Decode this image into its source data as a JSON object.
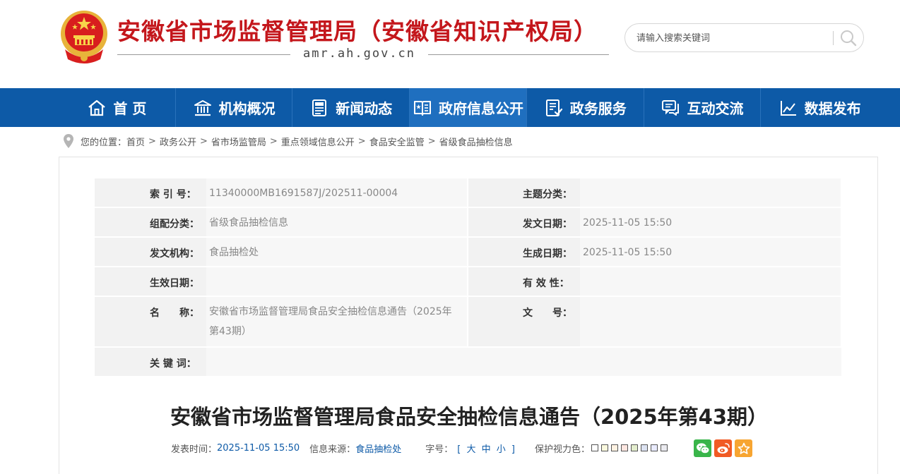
{
  "header": {
    "site_title": "安徽省市场监督管理局（安徽省知识产权局）",
    "domain": "amr.ah.gov.cn",
    "search_placeholder": "请输入搜索关键词"
  },
  "nav": {
    "items": [
      {
        "label": "首 页",
        "icon": "home-icon"
      },
      {
        "label": "机构概况",
        "icon": "institution-icon"
      },
      {
        "label": "新闻动态",
        "icon": "news-icon"
      },
      {
        "label": "政府信息公开",
        "icon": "gov-info-icon"
      },
      {
        "label": "政务服务",
        "icon": "service-icon"
      },
      {
        "label": "互动交流",
        "icon": "chat-icon"
      },
      {
        "label": "数据发布",
        "icon": "chart-icon"
      }
    ],
    "active_index": 3
  },
  "breadcrumb": {
    "prefix": "您的位置：",
    "items": [
      "首页",
      "政务公开",
      "省市场监管局",
      "重点领域信息公开",
      "食品安全监管",
      "省级食品抽检信息"
    ]
  },
  "meta": {
    "index_label": "索 引 号：",
    "index_value": "11340000MB1691587J/202511-00004",
    "topic_label": "主题分类：",
    "topic_value": "",
    "category_label": "组配分类：",
    "category_value": "省级食品抽检信息",
    "issue_date_label": "发文日期：",
    "issue_date_value": "2025-11-05 15:50",
    "org_label": "发文机构：",
    "org_value": "食品抽检处",
    "gen_date_label": "生成日期：",
    "gen_date_value": "2025-11-05 15:50",
    "effective_label": "生效日期：",
    "effective_value": "",
    "validity_label": "有 效 性：",
    "validity_value": "",
    "name_label": "名　　称：",
    "name_value": "安徽省市场监督管理局食品安全抽检信息通告（2025年第43期）",
    "doc_no_label": "文　　号：",
    "doc_no_value": "",
    "keywords_label": "关 键 词：",
    "keywords_value": ""
  },
  "article": {
    "title": "安徽省市场监督管理局食品安全抽检信息通告（2025年第43期）",
    "publish_label": "发表时间：",
    "publish_value": "2025-11-05 15:50",
    "source_label": "信息来源：",
    "source_value": "食品抽检处",
    "font_label": "字号：",
    "font_open": "[",
    "font_large": "大",
    "font_medium": "中",
    "font_small": "小",
    "font_close": "]",
    "eye_label": "保护视力色：",
    "swatch_colors": [
      "#ffffff",
      "#faf9de",
      "#fff2e2",
      "#fde6e0",
      "#e3edcd",
      "#dce2f1",
      "#e9ebfe",
      "#eaeaef"
    ]
  },
  "share": [
    {
      "icon": "wechat-icon",
      "color": "#39b54a"
    },
    {
      "icon": "weibo-icon",
      "color": "#f15a24"
    },
    {
      "icon": "star-icon",
      "color": "#f7a531"
    }
  ],
  "colors": {
    "brand_red": "#c4171c",
    "nav_blue": "#0d5aa7",
    "nav_active": "#1f6fbf"
  }
}
